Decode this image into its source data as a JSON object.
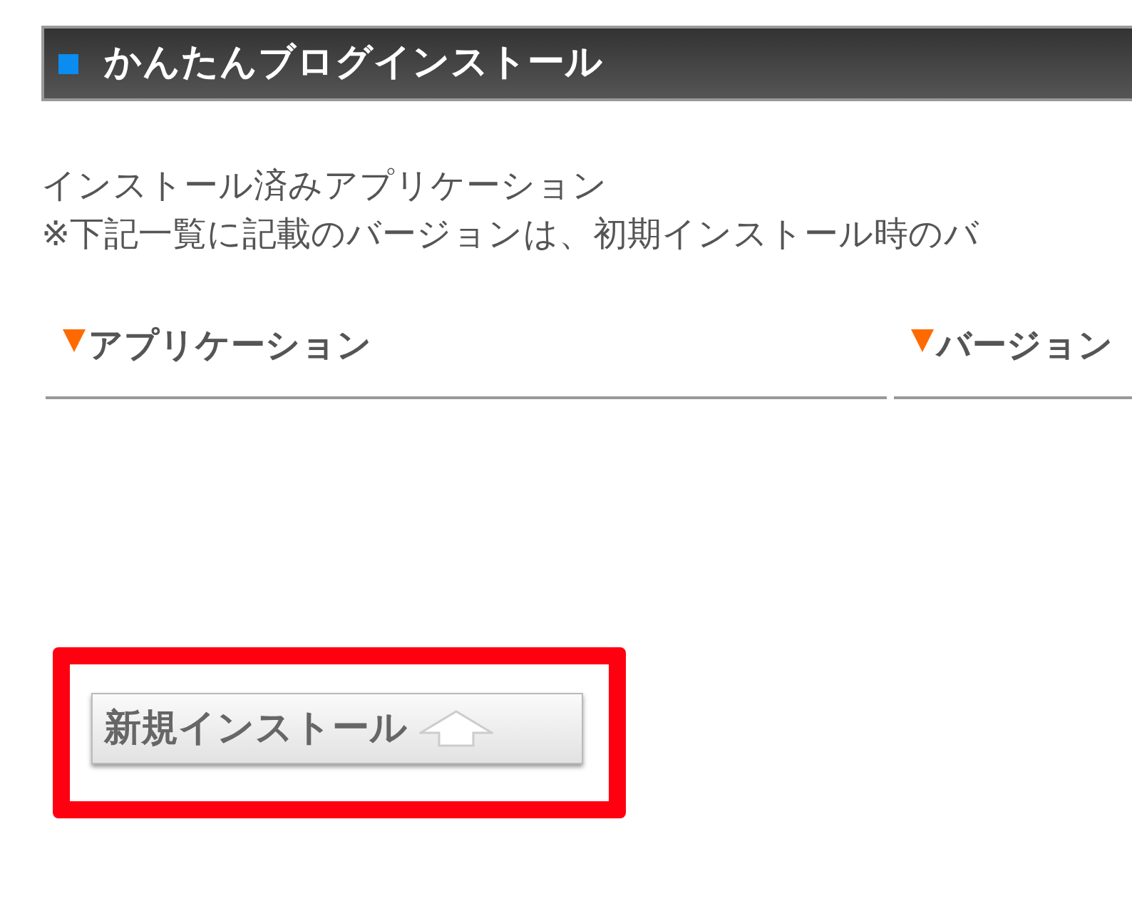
{
  "section_header": {
    "title": "かんたんブログインストール"
  },
  "intro": [
    "インストール済みアプリケーション",
    "※下記一覧に記載のバージョンは、初期インストール時のバ"
  ],
  "table": {
    "columns": [
      "アプリケーション",
      "バージョン"
    ]
  },
  "install_button": {
    "label": "新規インストール",
    "highlighted": true
  }
}
